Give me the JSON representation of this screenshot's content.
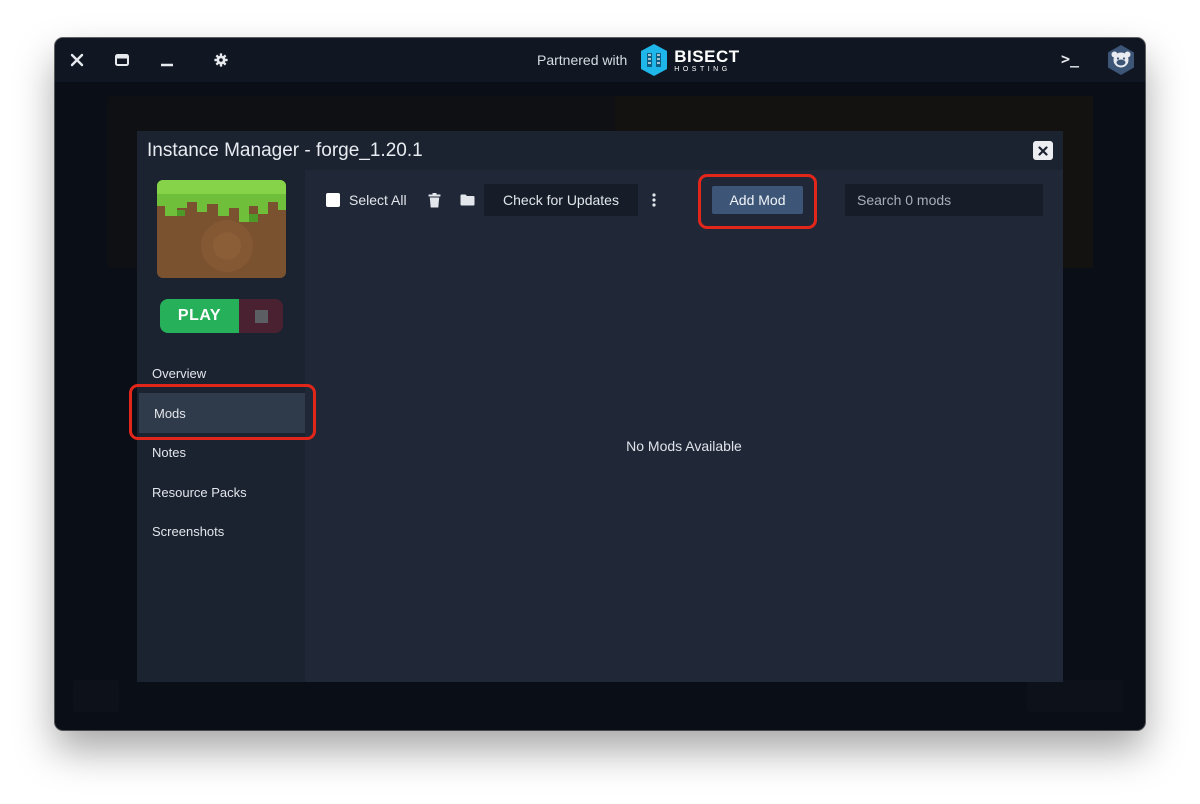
{
  "titlebar": {
    "partner_text": "Partnered with",
    "partner_brand": "BISECT",
    "partner_brand_sub": "HOSTING",
    "terminal_glyph": ">_",
    "icons": [
      "close-icon",
      "window-icon",
      "minimize-icon",
      "gear-icon",
      "terminal-icon",
      "account-icon"
    ]
  },
  "modal": {
    "title": "Instance Manager - forge_1.20.1",
    "close_icon": "close-icon"
  },
  "sidebar": {
    "play_label": "PLAY",
    "nav_items": [
      {
        "label": "Overview",
        "active": false
      },
      {
        "label": "Mods",
        "active": true
      },
      {
        "label": "Notes",
        "active": false
      },
      {
        "label": "Resource Packs",
        "active": false
      },
      {
        "label": "Screenshots",
        "active": false
      }
    ]
  },
  "toolbar": {
    "select_all_label": "Select All",
    "check_updates_label": "Check for Updates",
    "add_mod_label": "Add Mod",
    "search_placeholder": "Search 0 mods",
    "icons": [
      "checkbox",
      "trash-icon",
      "folder-icon",
      "more-vertical-icon"
    ]
  },
  "content": {
    "empty_message": "No Mods Available"
  },
  "colors": {
    "play": "#27b05a",
    "accent_button": "#3d5678",
    "highlight": "#e3261a",
    "brand_blue": "#1fb6ea"
  }
}
